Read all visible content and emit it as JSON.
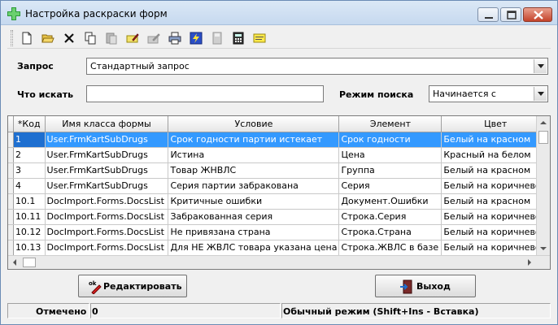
{
  "window": {
    "title": "Настройка раскраски форм"
  },
  "toolbar": {
    "buttons": [
      {
        "name": "new-doc-icon"
      },
      {
        "name": "open-folder-icon"
      },
      {
        "name": "delete-x-icon"
      },
      {
        "name": "copy-icon"
      },
      {
        "name": "paste-icon"
      },
      {
        "name": "edit-pencil-icon"
      },
      {
        "name": "edit-disabled-icon"
      },
      {
        "name": "print-icon"
      },
      {
        "name": "execute-icon"
      },
      {
        "name": "save-disabled-icon"
      },
      {
        "name": "calculator-icon"
      },
      {
        "name": "note-icon"
      }
    ]
  },
  "query": {
    "label": "Запрос",
    "value": "Стандартный запрос"
  },
  "search": {
    "label": "Что искать",
    "value": "",
    "mode_label": "Режим поиска",
    "mode_value": "Начинается с"
  },
  "grid": {
    "columns": [
      "*Код",
      "Имя класса формы",
      "Условие",
      "Элемент",
      "Цвет"
    ],
    "rows": [
      {
        "code": "1",
        "form_class": "User.FrmKartSubDrugs",
        "condition": "Срок годности партии истекает",
        "element": "Срок годности",
        "color": "Белый на красном"
      },
      {
        "code": "2",
        "form_class": "User.FrmKartSubDrugs",
        "condition": "Истина",
        "element": "Цена",
        "color": "Красный на белом"
      },
      {
        "code": "3",
        "form_class": "User.FrmKartSubDrugs",
        "condition": "Товар ЖНВЛС",
        "element": "Группа",
        "color": "Белый на красном"
      },
      {
        "code": "4",
        "form_class": "User.FrmKartSubDrugs",
        "condition": "Серия партии забракована",
        "element": "Серия",
        "color": "Белый на коричневом"
      },
      {
        "code": "10.1",
        "form_class": "DocImport.Forms.DocsList",
        "condition": "Критичные ошибки",
        "element": "Документ.Ошибки",
        "color": "Белый на красном"
      },
      {
        "code": "10.11",
        "form_class": "DocImport.Forms.DocsList",
        "condition": "Забракованная серия",
        "element": "Строка.Серия",
        "color": "Белый на коричневом"
      },
      {
        "code": "10.12",
        "form_class": "DocImport.Forms.DocsList",
        "condition": "Не привязана страна",
        "element": "Строка.Страна",
        "color": "Белый на коричневом"
      },
      {
        "code": "10.13",
        "form_class": "DocImport.Forms.DocsList",
        "condition": "Для НЕ ЖВЛС товара указана цена",
        "element": "Строка.ЖВЛС в базе",
        "color": "Белый на коричневом"
      }
    ],
    "selected_row": 0
  },
  "buttons": {
    "edit_label": "Редактировать",
    "exit_label": "Выход"
  },
  "status": {
    "marked_label": "Отмечено",
    "marked_count": "0",
    "mode_text": "Обычный режим (Shift+Ins - Вставка)"
  },
  "colors": {
    "selection": "#3399ff",
    "close_button": "#c4432b",
    "window_border": "#6b8bb5"
  }
}
